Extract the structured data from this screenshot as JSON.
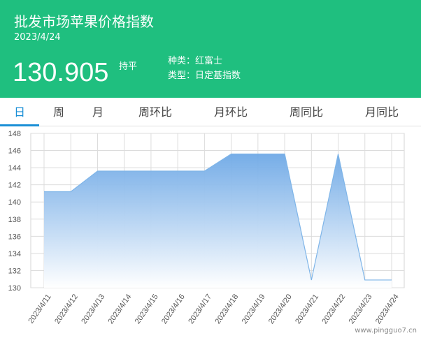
{
  "header": {
    "title": "批发市场苹果价格指数",
    "date": "2023/4/24",
    "price": "130.905",
    "change": "持平",
    "variety": "种类：红富士",
    "type": "类型：日定基指数"
  },
  "tabs": [
    {
      "label": "日",
      "active": true
    },
    {
      "label": "周",
      "active": false
    },
    {
      "label": "月",
      "active": false
    },
    {
      "label": "周环比",
      "active": false
    },
    {
      "label": "月环比",
      "active": false
    },
    {
      "label": "周同比",
      "active": false
    },
    {
      "label": "月同比",
      "active": false
    }
  ],
  "chart_data": {
    "type": "area",
    "categories": [
      "2023/4/11",
      "2023/4/12",
      "2023/4/13",
      "2023/4/14",
      "2023/4/15",
      "2023/4/16",
      "2023/4/17",
      "2023/4/18",
      "2023/4/19",
      "2023/4/20",
      "2023/4/21",
      "2023/4/22",
      "2023/4/23",
      "2023/4/24"
    ],
    "values": [
      141.2,
      141.2,
      143.6,
      143.6,
      143.6,
      143.6,
      143.6,
      145.6,
      145.6,
      145.6,
      130.9,
      145.6,
      130.9,
      130.9
    ],
    "ylim": [
      130,
      148
    ],
    "yticks": [
      130,
      132,
      134,
      136,
      138,
      140,
      142,
      144,
      146,
      148
    ],
    "grid": true,
    "colors": {
      "line": "#7fb5e8",
      "fill_top": "#6fa9e6",
      "fill_bottom": "#ffffff"
    }
  },
  "watermark": "www.pingguo7.cn"
}
